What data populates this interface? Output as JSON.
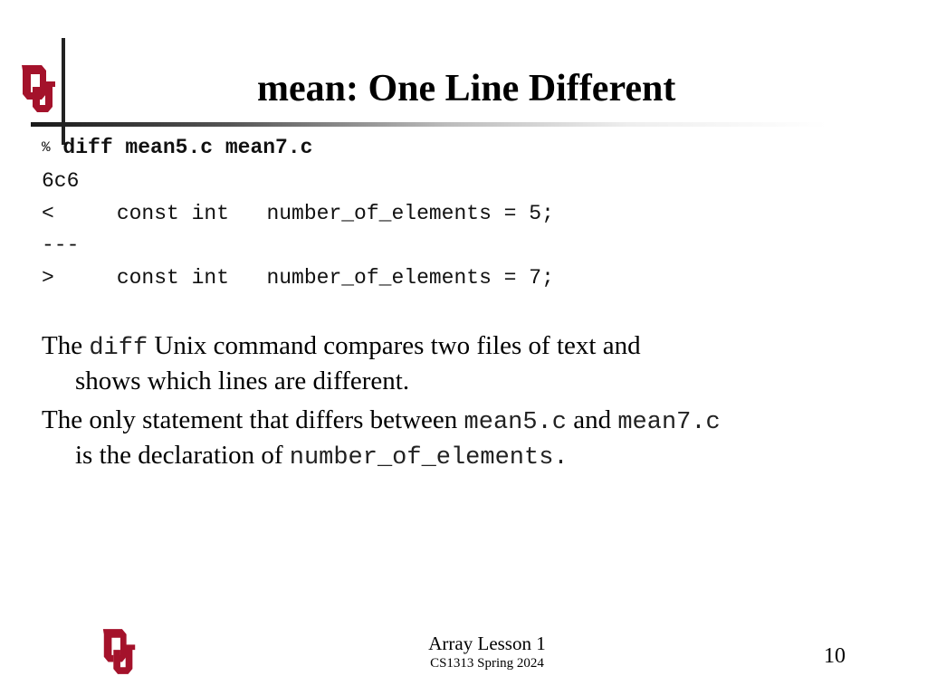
{
  "brand": {
    "logo_icon": "ou-logo-icon",
    "logo_color": "#A4122B"
  },
  "slide": {
    "title": "mean: One Line Different",
    "terminal": {
      "prompt": "%",
      "command": "diff mean5.c mean7.c",
      "lines": [
        "6c6",
        "<     const int   number_of_elements = 5;",
        "---",
        ">     const int   number_of_elements = 7;"
      ]
    },
    "paragraphs": [
      {
        "t1": "The ",
        "code1": "diff",
        "t2": " Unix command compares two files of text and",
        "t3": "shows which lines are different."
      },
      {
        "t1": "The only statement that differs between ",
        "code1": "mean5.c",
        "t2": " and ",
        "code2": "mean7.c",
        "t3": "is the declaration of ",
        "code3": "number_of_elements."
      }
    ]
  },
  "footer": {
    "lesson": "Array Lesson 1",
    "course": "CS1313 Spring 2024",
    "page_number": "10"
  }
}
